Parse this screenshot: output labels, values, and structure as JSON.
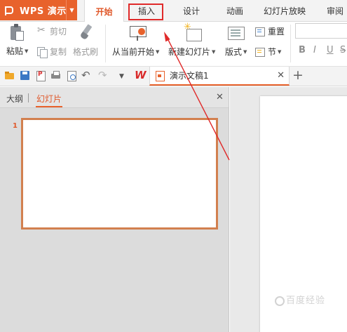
{
  "app": {
    "title": "WPS 演示"
  },
  "menu_tabs": [
    {
      "label": "开始",
      "active": true
    },
    {
      "label": "插入",
      "active": false
    },
    {
      "label": "设计",
      "active": false
    },
    {
      "label": "动画",
      "active": false
    },
    {
      "label": "幻灯片放映",
      "active": false
    },
    {
      "label": "审阅",
      "active": false
    }
  ],
  "ribbon": {
    "paste": "粘贴",
    "cut": "剪切",
    "copy": "复制",
    "format_painter": "格式刷",
    "from_current": "从当前开始",
    "new_slide": "新建幻灯片",
    "layout": "版式",
    "reset": "重置",
    "section": "节"
  },
  "font_format_buttons": [
    "B",
    "I",
    "U",
    "S"
  ],
  "document": {
    "tab_name": "演示文稿1"
  },
  "side_panel": {
    "outline_tab": "大纲",
    "slides_tab": "幻灯片",
    "slide_number": "1"
  },
  "watermark": "百度经验",
  "colors": {
    "accent": "#e8622c",
    "highlight_box": "#e02a2a",
    "panel_bg": "#dcdcdc",
    "thumb_border": "#d2804f"
  },
  "icons": {
    "paste": "clipboard-icon",
    "cut": "scissors-icon",
    "copy": "copy-icon",
    "format_painter": "brush-icon",
    "from_current": "projector-icon",
    "new_slide": "new-slide-icon",
    "layout": "layout-icon"
  }
}
